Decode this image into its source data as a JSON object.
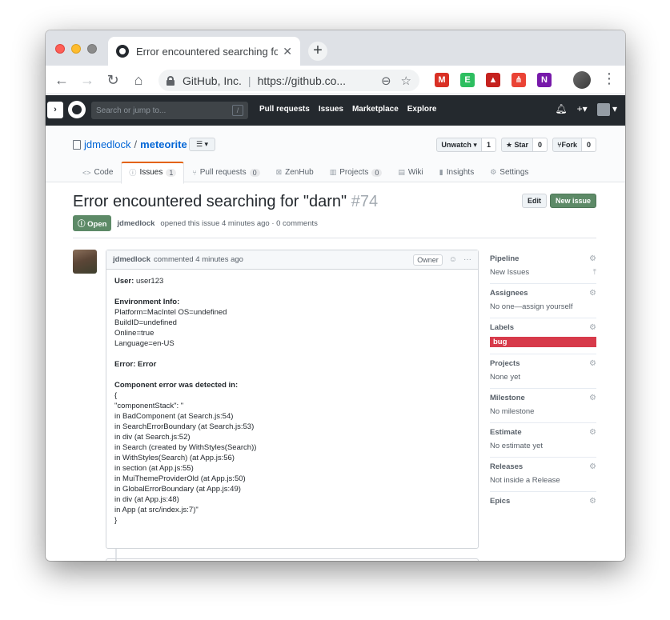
{
  "browser": {
    "tab_title": "Error encountered searching fo",
    "tab_close": "✕",
    "new_tab": "+",
    "org": "GitHub, Inc.",
    "url": "https://github.co...",
    "extensions": [
      {
        "name": "gmail-icon",
        "label": "M",
        "color": "#d93025"
      },
      {
        "name": "evernote-icon",
        "label": "E",
        "color": "#2dbe60"
      },
      {
        "name": "drive-icon",
        "label": "▲",
        "color": "#c5221f"
      },
      {
        "name": "network-icon",
        "label": "⋔",
        "color": "#ea4335"
      },
      {
        "name": "onenote-icon",
        "label": "N",
        "color": "#7719aa"
      }
    ]
  },
  "github": {
    "search_placeholder": "Search or jump to...",
    "search_key": "/",
    "nav": [
      "Pull requests",
      "Issues",
      "Marketplace",
      "Explore"
    ],
    "plus": "+▾"
  },
  "repo": {
    "owner": "jdmedlock",
    "separator": "/",
    "name": "meteorite",
    "menu_button": "☰ ▾",
    "unwatch": {
      "label": "Unwatch ▾",
      "count": "1"
    },
    "star": {
      "label": "★ Star",
      "count": "0"
    },
    "fork": {
      "label": "Fork",
      "count": "0"
    },
    "tabs": [
      {
        "label": "Code",
        "icon": "<>",
        "counter": ""
      },
      {
        "label": "Issues",
        "icon": "ⓘ",
        "counter": "1"
      },
      {
        "label": "Pull requests",
        "icon": "⑂",
        "counter": "0"
      },
      {
        "label": "ZenHub",
        "icon": "⊠",
        "counter": ""
      },
      {
        "label": "Projects",
        "icon": "▥",
        "counter": "0"
      },
      {
        "label": "Wiki",
        "icon": "▤",
        "counter": ""
      },
      {
        "label": "Insights",
        "icon": "▮",
        "counter": ""
      },
      {
        "label": "Settings",
        "icon": "⚙",
        "counter": ""
      }
    ]
  },
  "issue": {
    "title": "Error encountered searching for \"darn\"",
    "number": "#74",
    "edit_label": "Edit",
    "new_issue_label": "New issue",
    "state": "Open",
    "author": "jdmedlock",
    "meta": "opened this issue 4 minutes ago · 0 comments"
  },
  "comment": {
    "author": "jdmedlock",
    "time": "commented 4 minutes ago",
    "owner_badge": "Owner",
    "react": "☺",
    "dots": "···",
    "user_label": "User:",
    "user_value": "user123",
    "env_label": "Environment Info:",
    "env_lines": [
      "Platform=MacIntel OS=undefined",
      "BuildID=undefined",
      "Online=true",
      "Language=en-US"
    ],
    "error_label": "Error: Error",
    "component_label": "Component error was detected in:",
    "stack_lines": [
      "{",
      "\"componentStack\": \"",
      "in BadComponent (at Search.js:54)",
      "in SearchErrorBoundary (at Search.js:53)",
      "in div (at Search.js:52)",
      "in Search (created by WithStyles(Search))",
      "in WithStyles(Search) (at App.js:56)",
      "in section (at App.js:55)",
      "in MuiThemeProviderOld (at App.js:50)",
      "in GlobalErrorBoundary (at App.js:49)",
      "in div (at App.js:48)",
      "in App (at src/index.js:7)\"",
      "}"
    ]
  },
  "sidebar": [
    {
      "heading": "Pipeline",
      "value": "New Issues",
      "extra": "⤒"
    },
    {
      "heading": "Assignees",
      "value": "No one—assign yourself",
      "extra": ""
    },
    {
      "heading": "Labels",
      "value": "bug",
      "extra": "",
      "label_color": "#d73a4a"
    },
    {
      "heading": "Projects",
      "value": "None yet",
      "extra": ""
    },
    {
      "heading": "Milestone",
      "value": "No milestone",
      "extra": ""
    },
    {
      "heading": "Estimate",
      "value": "No estimate yet",
      "extra": ""
    },
    {
      "heading": "Releases",
      "value": "Not inside a Release",
      "extra": ""
    },
    {
      "heading": "Epics",
      "value": "",
      "extra": ""
    }
  ]
}
